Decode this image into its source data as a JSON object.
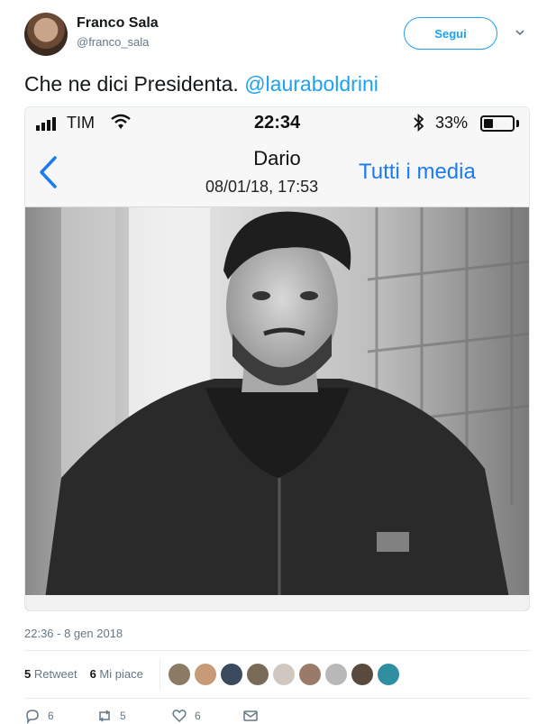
{
  "tweet": {
    "author_name": "Franco Sala",
    "author_handle": "@franco_sala",
    "follow_label": "Segui",
    "text": "Che ne dici Presidenta. ",
    "mention": "@lauraboldrini",
    "timestamp": "22:36 - 8 gen 2018"
  },
  "phone": {
    "carrier": "TIM",
    "time": "22:34",
    "battery": "33%",
    "battery_level": 0.33,
    "contact_name": "Dario",
    "contact_date": "08/01/18, 17:53",
    "all_media_label": "Tutti i media"
  },
  "stats": {
    "retweets_count": "5",
    "retweets_label": "Retweet",
    "likes_count": "6",
    "likes_label": "Mi piace"
  },
  "actions": {
    "reply_count": "6",
    "retweet_count": "5",
    "like_count": "6"
  },
  "colors": {
    "accent": "#1da1f2",
    "ios_blue": "#1a7bf2",
    "muted": "#657786"
  }
}
